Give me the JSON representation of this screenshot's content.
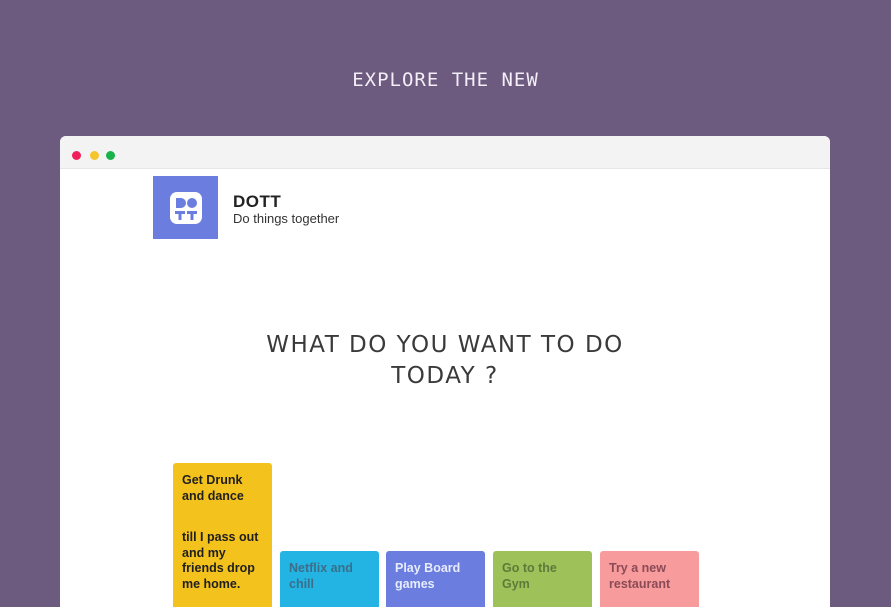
{
  "page": {
    "headline": "EXPLORE THE NEW"
  },
  "browser": {
    "window_controls": [
      "close",
      "minimize",
      "maximize"
    ]
  },
  "brand": {
    "logo_icon": "dott-logo-icon",
    "title": "DOTT",
    "subtitle": "Do things together"
  },
  "main": {
    "question": "WHAT DO YOU WANT TO DO TODAY ?",
    "activities": [
      {
        "label": "Get Drunk and dance",
        "label_extra": "till I pass out and my friends drop me home.",
        "color": "#f4c21d"
      },
      {
        "label": "Netflix and chill",
        "color": "#23b4e3"
      },
      {
        "label": "Play Board games",
        "color": "#6b7ddf"
      },
      {
        "label": "Go to the Gym",
        "color": "#9fc15a"
      },
      {
        "label": "Try a new restaurant",
        "color": "#f79b9c"
      }
    ]
  }
}
